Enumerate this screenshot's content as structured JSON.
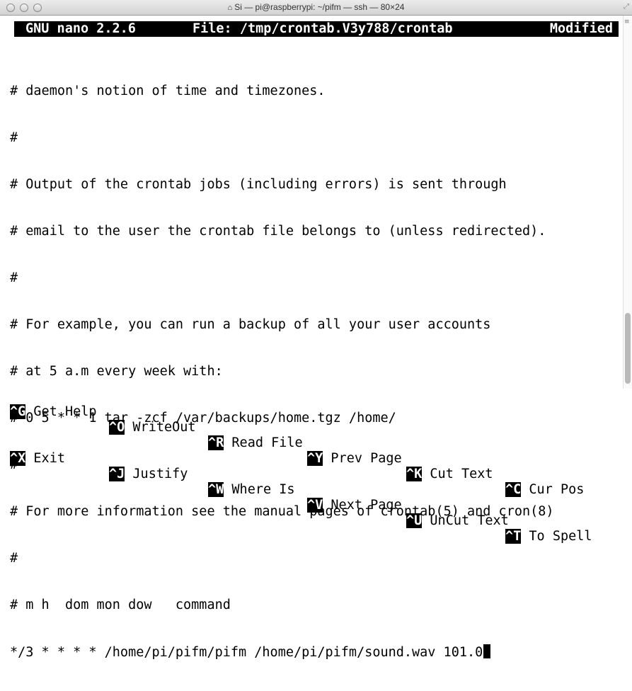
{
  "window": {
    "title": "Si — pi@raspberrypi: ~/pifm — ssh — 80×24",
    "home_icon": "house-icon",
    "resize_icon": "resize-icon"
  },
  "nano": {
    "app": "GNU nano 2.2.6",
    "file": "File: /tmp/crontab.V3y788/crontab",
    "status": "Modified"
  },
  "lines": [
    "# daemon's notion of time and timezones.",
    "#",
    "# Output of the crontab jobs (including errors) is sent through",
    "# email to the user the crontab file belongs to (unless redirected).",
    "#",
    "# For example, you can run a backup of all your user accounts",
    "# at 5 a.m every week with:",
    "# 0 5 * * 1 tar -zcf /var/backups/home.tgz /home/",
    "#",
    "# For more information see the manual pages of crontab(5) and cron(8)",
    "#",
    "# m h  dom mon dow   command",
    "*/3 * * * * /home/pi/pifm/pifm /home/pi/pifm/sound.wav 101.0"
  ],
  "shortcuts_row1": [
    {
      "key": "^G",
      "label": "Get Help"
    },
    {
      "key": "^O",
      "label": "WriteOut"
    },
    {
      "key": "^R",
      "label": "Read File"
    },
    {
      "key": "^Y",
      "label": "Prev Page"
    },
    {
      "key": "^K",
      "label": "Cut Text"
    },
    {
      "key": "^C",
      "label": "Cur Pos"
    }
  ],
  "shortcuts_row2": [
    {
      "key": "^X",
      "label": "Exit"
    },
    {
      "key": "^J",
      "label": "Justify"
    },
    {
      "key": "^W",
      "label": "Where Is"
    },
    {
      "key": "^V",
      "label": "Next Page"
    },
    {
      "key": "^U",
      "label": "UnCut Text"
    },
    {
      "key": "^T",
      "label": "To Spell"
    }
  ]
}
